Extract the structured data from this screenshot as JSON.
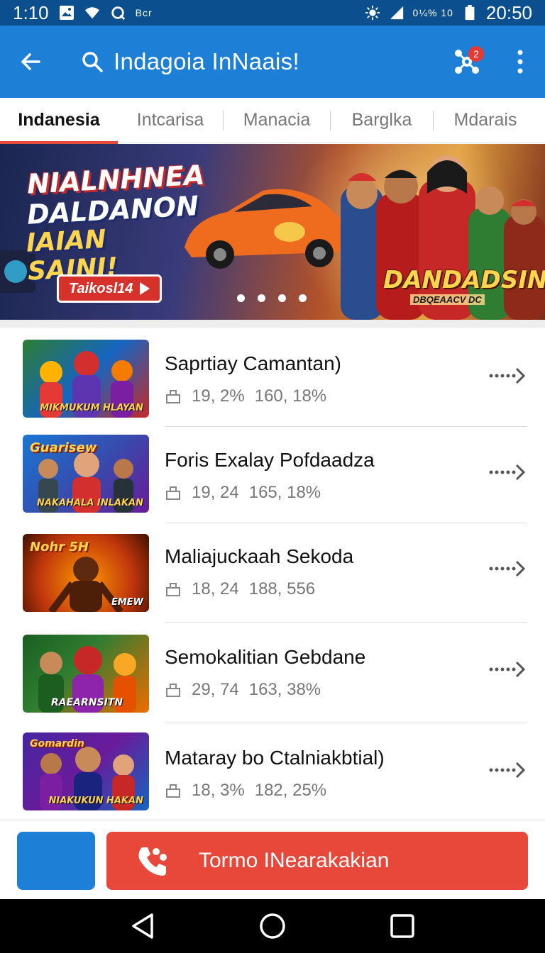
{
  "status_bar": {
    "time_left": "1:10",
    "carrier": "Bcr",
    "signal_label": "0¼% 10",
    "time_right": "20:50"
  },
  "app_bar": {
    "title": "Indagoia InNaais!",
    "cart_badge": "2",
    "back_icon": "arrow-left-icon",
    "search_icon": "search-icon",
    "cart_icon": "settings-network-icon",
    "menu_icon": "more-vertical-icon"
  },
  "tabs": [
    {
      "label": "Indanesia",
      "active": true
    },
    {
      "label": "Intcarisa",
      "active": false
    },
    {
      "label": "Manacia",
      "active": false
    },
    {
      "label": "Barglka",
      "active": false
    },
    {
      "label": "Mdarais",
      "active": false
    }
  ],
  "banner": {
    "headline_1": "NIALNHNEA",
    "headline_2": "DALDANON",
    "headline_3": "IAIAN SAINI!",
    "cta": "Taikosl14",
    "logo": "DANDADSIN",
    "logo_sub": "DBQEAACV DC",
    "slide_count": 4
  },
  "list": [
    {
      "title": "Saprtiay Camantan)",
      "stat_1": "19, 2%",
      "stat_2": "160, 18%",
      "thumb_top": "",
      "thumb_label": "MIKMUKUM HLAYAN"
    },
    {
      "title": "Foris Exalay Pofdaadza",
      "stat_1": "19, 24",
      "stat_2": "165, 18%",
      "thumb_top": "Guarisew",
      "thumb_label": "NAKAHALA INLAKAN"
    },
    {
      "title": "Maliajuckaah Sekoda",
      "stat_1": "18, 24",
      "stat_2": "188, 556",
      "thumb_top": "Nohr 5H",
      "thumb_label": "EMEW"
    },
    {
      "title": "Semokalitian Gebdane",
      "stat_1": "29, 74",
      "stat_2": "163, 38%",
      "thumb_top": "",
      "thumb_label": "RAEARNSITN"
    },
    {
      "title": "Mataray bo Ctalniakbtial)",
      "stat_1": "18, 3%",
      "stat_2": "182, 25%",
      "thumb_top": "Gomardin",
      "thumb_label": "NIAKUKUN HAKAN"
    }
  ],
  "bottom_bar": {
    "call_label": "Tormo INearakakian"
  },
  "colors": {
    "primary": "#1e7fd6",
    "status": "#0b4f8e",
    "accent": "#e8483a"
  }
}
